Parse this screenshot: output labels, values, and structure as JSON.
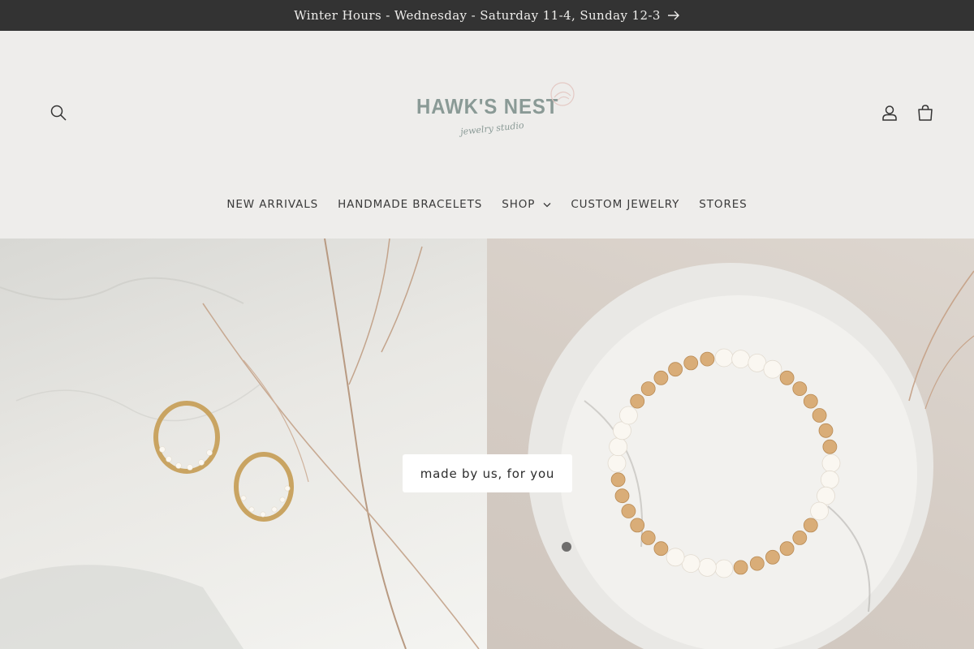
{
  "announcement": {
    "text": "Winter Hours - Wednesday - Saturday 11-4, Sunday 12-3",
    "icon": "arrow-right-icon"
  },
  "header": {
    "logo": {
      "title": "HAWK'S NEST",
      "subtitle": "jewelry studio"
    },
    "icons": {
      "search": "search-icon",
      "account": "account-icon",
      "cart": "cart-icon"
    }
  },
  "nav": {
    "items": [
      {
        "label": "NEW ARRIVALS"
      },
      {
        "label": "HANDMADE BRACELETS"
      },
      {
        "label": "SHOP",
        "has_dropdown": true
      },
      {
        "label": "CUSTOM JEWELRY"
      },
      {
        "label": "STORES"
      }
    ]
  },
  "hero": {
    "cta_label": "made by us, for you"
  },
  "colors": {
    "announcement_bg": "#333333",
    "header_bg": "#eeedeb",
    "text": "#3a3a3a",
    "logo": "#8a9a96"
  }
}
